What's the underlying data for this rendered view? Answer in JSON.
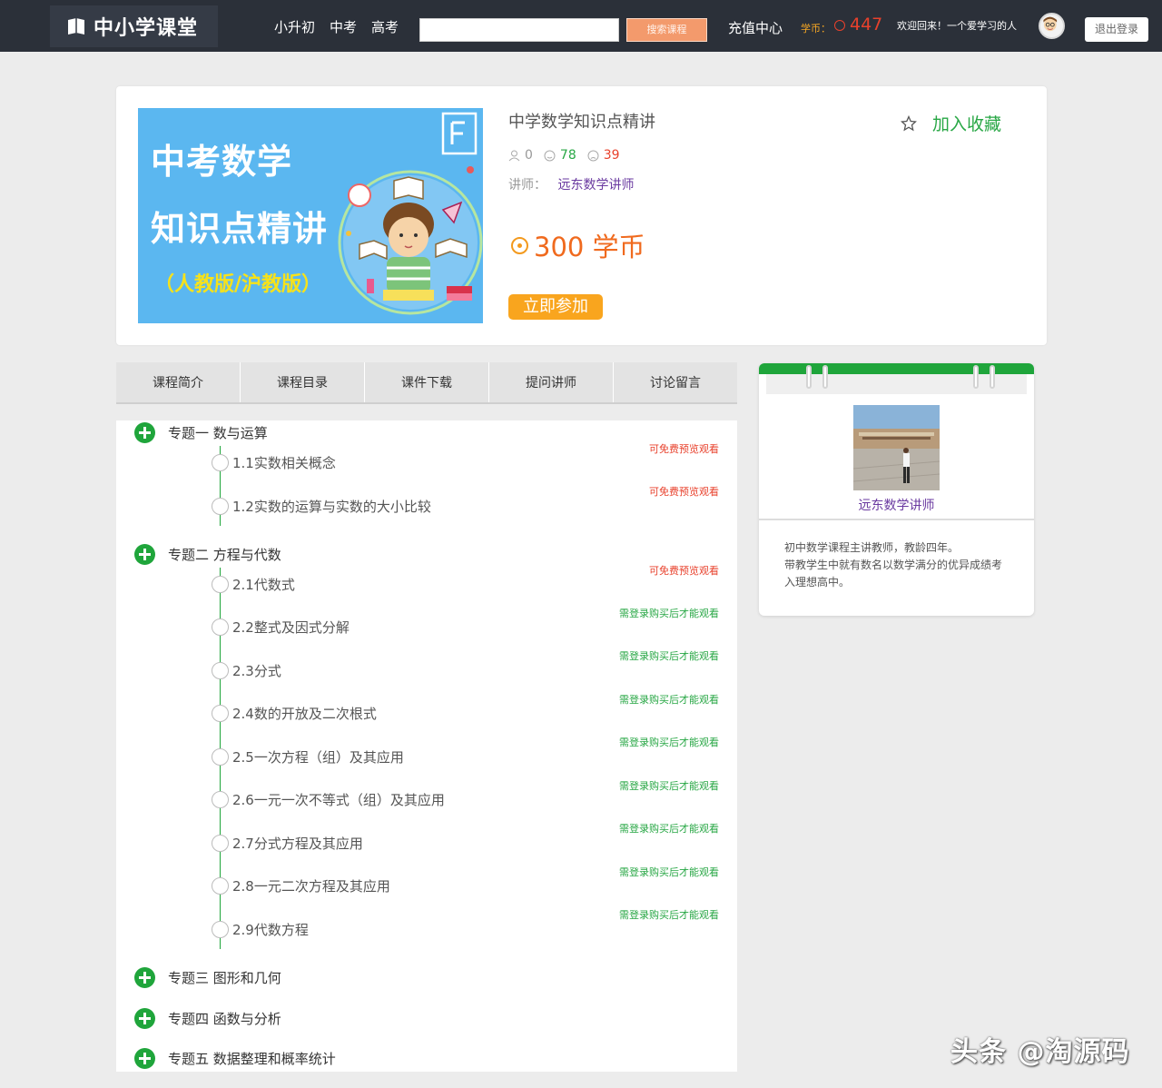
{
  "header": {
    "logo_text": "中小学课堂",
    "nav": [
      "小升初",
      "中考",
      "高考"
    ],
    "search": {
      "value": "",
      "button": "搜索课程"
    },
    "recharge": "充值中心",
    "coin_label": "学币：",
    "coin_value": "447",
    "welcome": "欢迎回来！",
    "username": "一个爱学习的人",
    "logout": "退出登录"
  },
  "course": {
    "cover": {
      "line1": "中考数学",
      "line2": "知识点精讲",
      "line3": "（人教版/沪教版）"
    },
    "title": "中学数学知识点精讲",
    "stats": {
      "students": "0",
      "likes": "78",
      "dislikes": "39"
    },
    "teacher_label": "讲师：",
    "teacher_name": "远东数学讲师",
    "price": "300 学币",
    "join": "立即参加",
    "favorite": "加入收藏"
  },
  "tabs": [
    "课程简介",
    "课程目录",
    "课件下载",
    "提问讲师",
    "讨论留言"
  ],
  "catalog": {
    "chapters": [
      {
        "title": "专题一 数与运算",
        "lessons": [
          {
            "title": "1.1实数相关概念",
            "tag": "可免费预览观看",
            "free": true
          },
          {
            "title": "1.2实数的运算与实数的大小比较",
            "tag": "可免费预览观看",
            "free": true
          }
        ]
      },
      {
        "title": "专题二 方程与代数",
        "lessons": [
          {
            "title": "2.1代数式",
            "tag": "可免费预览观看",
            "free": true
          },
          {
            "title": "2.2整式及因式分解",
            "tag": "需登录购买后才能观看",
            "free": false
          },
          {
            "title": "2.3分式",
            "tag": "需登录购买后才能观看",
            "free": false
          },
          {
            "title": "2.4数的开放及二次根式",
            "tag": "需登录购买后才能观看",
            "free": false
          },
          {
            "title": "2.5一次方程（组）及其应用",
            "tag": "需登录购买后才能观看",
            "free": false
          },
          {
            "title": "2.6一元一次不等式（组）及其应用",
            "tag": "需登录购买后才能观看",
            "free": false
          },
          {
            "title": "2.7分式方程及其应用",
            "tag": "需登录购买后才能观看",
            "free": false
          },
          {
            "title": "2.8一元二次方程及其应用",
            "tag": "需登录购买后才能观看",
            "free": false
          },
          {
            "title": "2.9代数方程",
            "tag": "需登录购买后才能观看",
            "free": false
          }
        ]
      },
      {
        "title": "专题三 图形和几何",
        "lessons": []
      },
      {
        "title": "专题四 函数与分析",
        "lessons": []
      },
      {
        "title": "专题五 数据整理和概率统计",
        "lessons": []
      }
    ]
  },
  "teacher_panel": {
    "name": "远东数学讲师",
    "desc_line1": "初中数学课程主讲教师，教龄四年。",
    "desc_line2": "带教学生中就有数名以数学满分的优异成绩考入理想高中。"
  },
  "watermark": "头条 @淘源码",
  "colors": {
    "header_bg": "#2b3039",
    "accent_green": "#1fa53b",
    "price_orange": "#f06a1e",
    "coin_red": "#e8412c",
    "join_btn": "#f9a51e"
  }
}
